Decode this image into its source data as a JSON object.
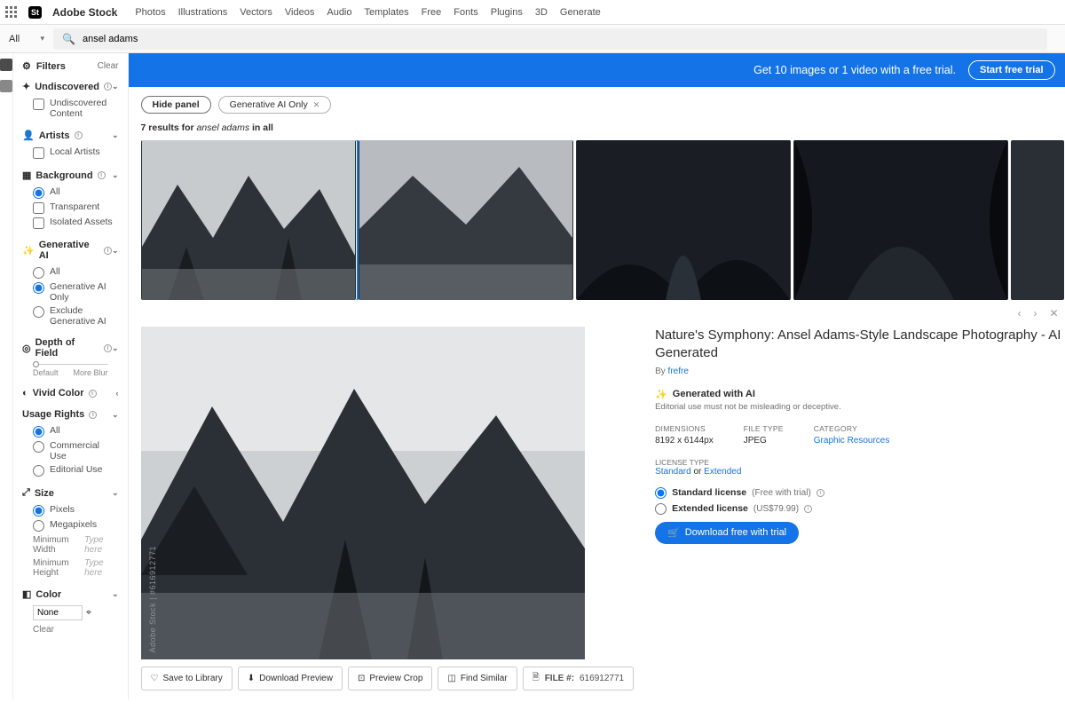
{
  "header": {
    "brand": "Adobe Stock",
    "nav": [
      "Photos",
      "Illustrations",
      "Vectors",
      "Videos",
      "Audio",
      "Templates",
      "Free",
      "Fonts",
      "Plugins",
      "3D",
      "Generate"
    ]
  },
  "search": {
    "category": "All",
    "query": "ansel adams"
  },
  "banner": {
    "text": "Get 10 images or 1 video with a free trial.",
    "cta": "Start free trial"
  },
  "filters": {
    "title": "Filters",
    "clear": "Clear",
    "undiscovered": {
      "label": "Undiscovered",
      "opt": "Undiscovered Content"
    },
    "artists": {
      "label": "Artists",
      "opt": "Local Artists"
    },
    "background": {
      "label": "Background",
      "opts": [
        "All",
        "Transparent",
        "Isolated Assets"
      ]
    },
    "genai": {
      "label": "Generative AI",
      "opts": [
        "All",
        "Generative AI Only",
        "Exclude Generative AI"
      ]
    },
    "dof": {
      "label": "Depth of Field",
      "left": "Default",
      "right": "More Blur"
    },
    "vivid": {
      "label": "Vivid Color"
    },
    "usage": {
      "label": "Usage Rights",
      "opts": [
        "All",
        "Commercial Use",
        "Editorial Use"
      ]
    },
    "size": {
      "label": "Size",
      "opts": [
        "Pixels",
        "Megapixels"
      ],
      "minw": "Minimum Width",
      "minh": "Minimum Height",
      "ph": "Type here"
    },
    "color": {
      "label": "Color",
      "none": "None",
      "clear": "Clear"
    }
  },
  "chips": {
    "hide": "Hide panel",
    "tag": "Generative AI Only"
  },
  "results": {
    "count": "7 results for",
    "q": "ansel adams",
    "in": "in all"
  },
  "detail": {
    "title": "Nature's Symphony: Ansel Adams-Style Landscape Photography - AI Generated",
    "by": "By",
    "author": "frefre",
    "genai": "Generated with AI",
    "genai_note": "Editorial use must not be misleading or deceptive.",
    "dims_l": "DIMENSIONS",
    "dims": "8192 x 6144px",
    "ft_l": "FILE TYPE",
    "ft": "JPEG",
    "cat_l": "CATEGORY",
    "cat": "Graphic Resources",
    "lt_l": "LICENSE TYPE",
    "lt_std": "Standard",
    "lt_or": "or",
    "lt_ext": "Extended",
    "lic_std": "Standard license",
    "lic_std_note": "(Free with trial)",
    "lic_ext": "Extended license",
    "lic_ext_note": "(US$79.99)",
    "dl": "Download free with trial",
    "watermark": "Adobe Stock | #616912771",
    "fileid_l": "FILE #:",
    "fileid": "616912771"
  },
  "actions": {
    "save": "Save to Library",
    "dlprev": "Download Preview",
    "crop": "Preview Crop",
    "similar": "Find Similar"
  }
}
